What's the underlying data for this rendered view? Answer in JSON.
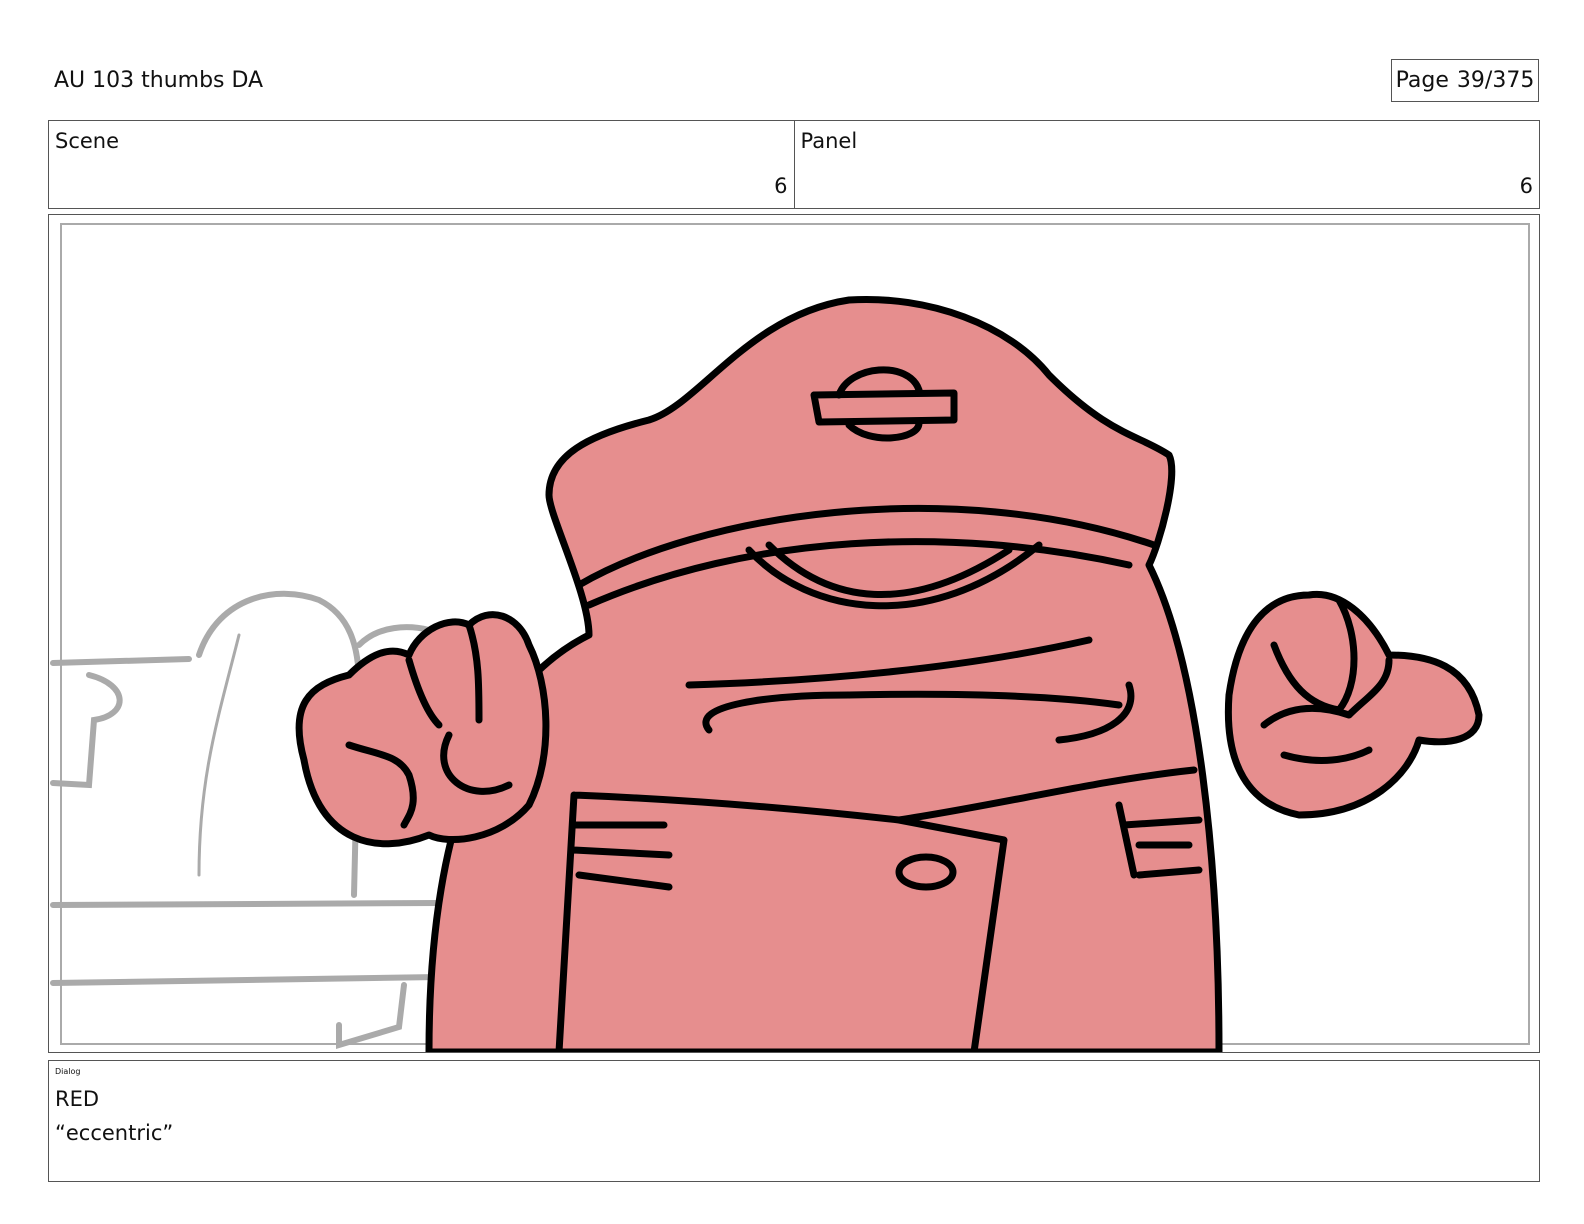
{
  "header": {
    "title": "AU 103 thumbs DA",
    "page_label": "Page",
    "page_value": "39/375"
  },
  "scene": {
    "label": "Scene",
    "value": "6"
  },
  "panel": {
    "label": "Panel",
    "value": "6"
  },
  "dialog": {
    "label": "Dialog",
    "character": "RED",
    "line": "“eccentric”"
  },
  "colors": {
    "fill": "#e68e8e",
    "outline": "#000000",
    "sketch": "#aaaaaa"
  }
}
